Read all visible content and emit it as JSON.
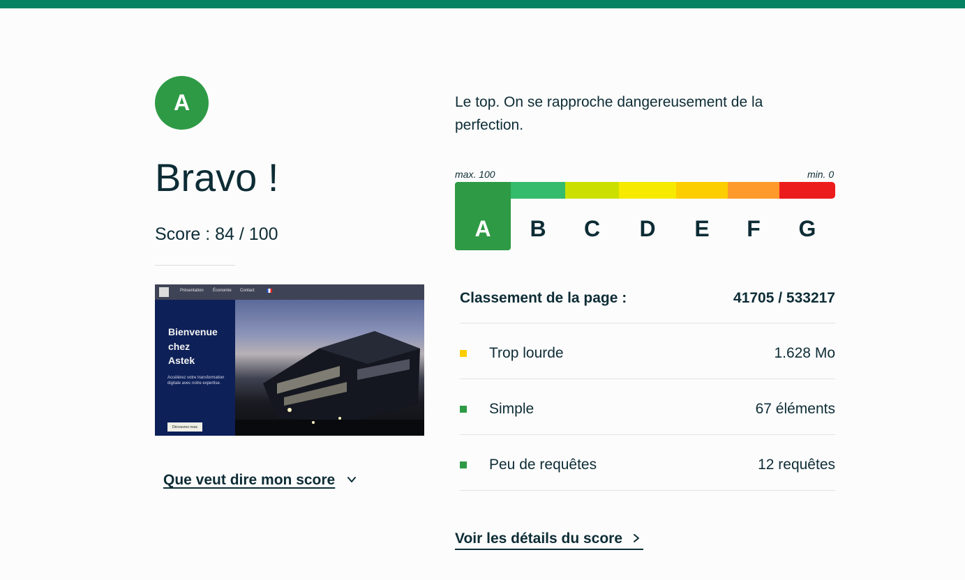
{
  "header": {
    "accent_color": "#048262"
  },
  "result": {
    "grade": "A",
    "grade_color": "#2e9a45",
    "title": "Bravo !",
    "score_text": "Score : 84 / 100",
    "comment": "Le top. On se rapproche dangereusement de la perfection."
  },
  "preview": {
    "nav_items": [
      "Présentation",
      "Économie",
      "Contact"
    ],
    "heading": "Bienvenue\nchez\nAstek",
    "subtitle": "Accélérez votre transformation digitale avec notre expertise.",
    "button": "Découvrez nous",
    "flag_icon": "french-flag-icon"
  },
  "scale": {
    "max_label": "max. 100",
    "min_label": "min. 0",
    "selected": "A",
    "grades": [
      {
        "letter": "A",
        "color": "#2e9a45"
      },
      {
        "letter": "B",
        "color": "#34bb6b"
      },
      {
        "letter": "C",
        "color": "#cbe000"
      },
      {
        "letter": "D",
        "color": "#f5ea00"
      },
      {
        "letter": "E",
        "color": "#fcce00"
      },
      {
        "letter": "F",
        "color": "#fd9a2b"
      },
      {
        "letter": "G",
        "color": "#ed1c1c"
      }
    ]
  },
  "ranking": {
    "label": "Classement de la page :",
    "value": "41705 / 533217"
  },
  "metrics": [
    {
      "label": "Trop lourde",
      "value": "1.628 Mo",
      "status_color": "#fcce00"
    },
    {
      "label": "Simple",
      "value": "67 éléments",
      "status_color": "#2e9a45"
    },
    {
      "label": "Peu de requêtes",
      "value": "12 requêtes",
      "status_color": "#2e9a45"
    }
  ],
  "links": {
    "whats_my_score": "Que veut dire mon score",
    "see_details": "Voir les détails du score",
    "chevron_down_icon": "chevron-down-icon",
    "chevron_right_icon": "chevron-right-icon"
  }
}
